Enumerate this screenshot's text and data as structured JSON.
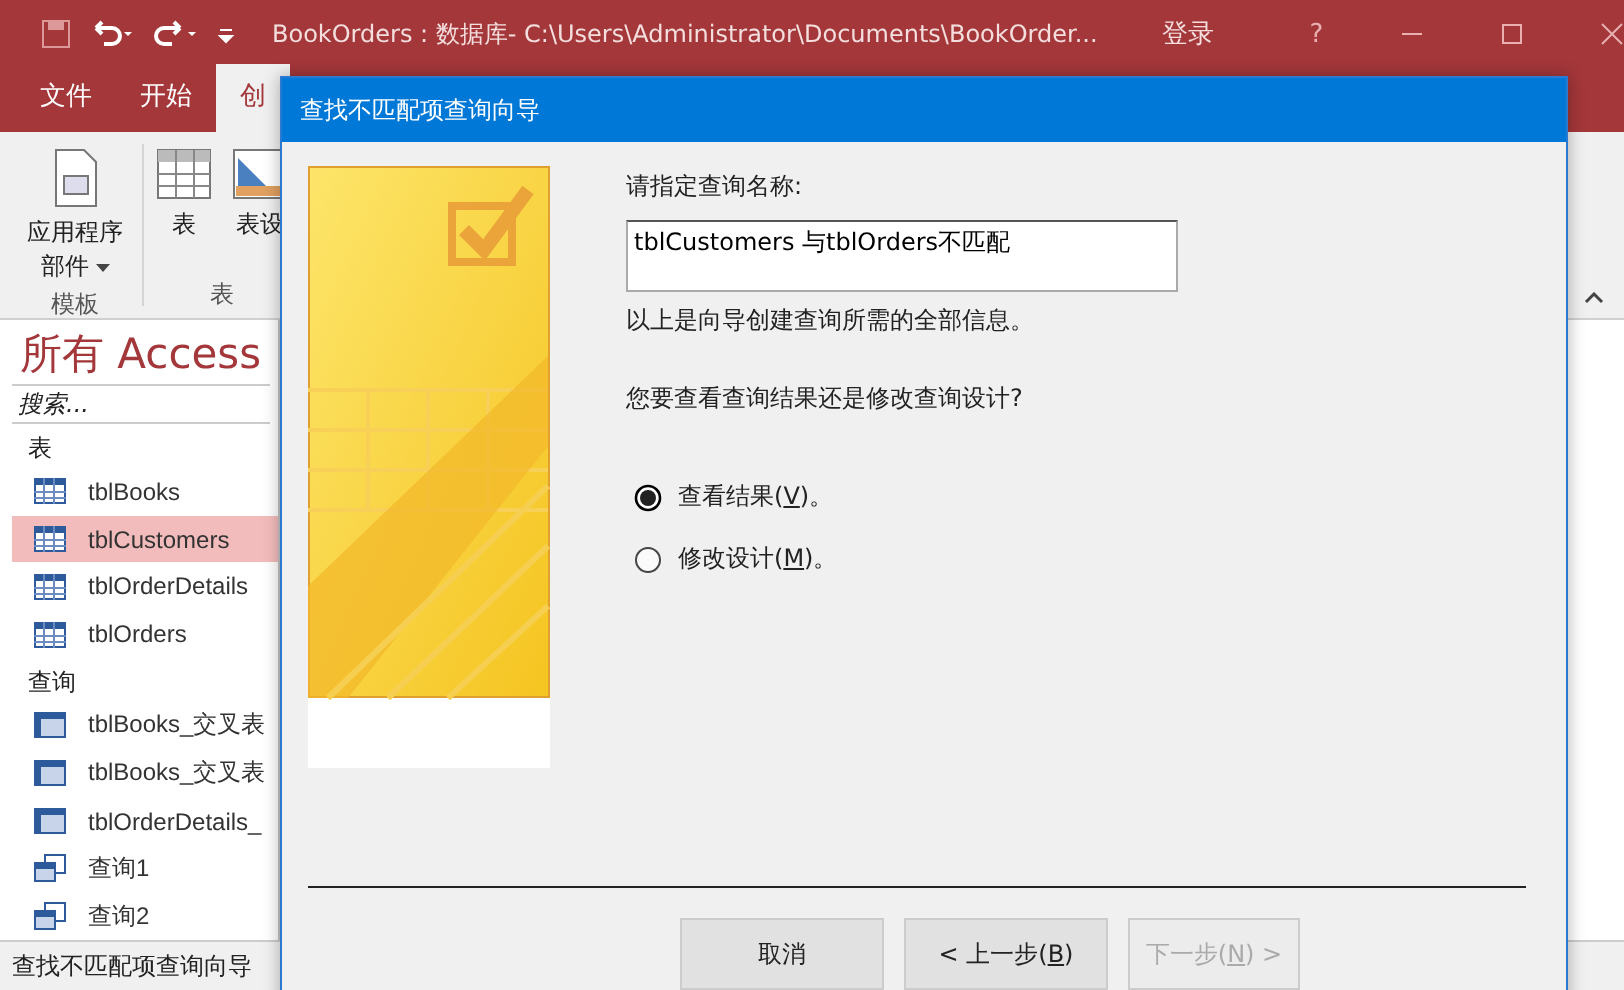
{
  "title_bar": {
    "title": "BookOrders : 数据库- C:\\Users\\Administrator\\Documents\\BookOrder...",
    "sign_in": "登录",
    "help": "?"
  },
  "ribbon_tabs": [
    {
      "label": "文件",
      "selected": false
    },
    {
      "label": "开始",
      "selected": false
    },
    {
      "label": "创",
      "selected": true
    }
  ],
  "ribbon": {
    "buttons": [
      {
        "label": "应用程序部件",
        "kind": "app-parts"
      },
      {
        "label": "表",
        "kind": "table"
      },
      {
        "label": "表设",
        "kind": "table-design"
      }
    ],
    "groups": [
      "模板",
      "表"
    ]
  },
  "nav_pane": {
    "title": "所有 Access",
    "search_placeholder": "搜索...",
    "groups": [
      {
        "label": "表",
        "items": [
          {
            "name": "tblBooks",
            "kind": "table",
            "selected": false
          },
          {
            "name": "tblCustomers",
            "kind": "table",
            "selected": true
          },
          {
            "name": "tblOrderDetails",
            "kind": "table",
            "selected": false
          },
          {
            "name": "tblOrders",
            "kind": "table",
            "selected": false
          }
        ]
      },
      {
        "label": "查询",
        "items": [
          {
            "name": "tblBooks_交叉表",
            "kind": "crosstab",
            "selected": false
          },
          {
            "name": "tblBooks_交叉表",
            "kind": "crosstab",
            "selected": false
          },
          {
            "name": "tblOrderDetails_",
            "kind": "crosstab",
            "selected": false
          },
          {
            "name": "查询1",
            "kind": "query",
            "selected": false
          },
          {
            "name": "查询2",
            "kind": "query",
            "selected": false
          }
        ]
      }
    ]
  },
  "status_bar": "查找不匹配项查询向导",
  "dialog": {
    "title": "查找不匹配项查询向导",
    "name_label": "请指定查询名称:",
    "name_value": "tblCustomers 与tblOrders不匹配",
    "info": "以上是向导创建查询所需的全部信息。",
    "question": "您要查看查询结果还是修改查询设计?",
    "options": [
      {
        "prefix": "查看结果(",
        "key": "V",
        "suffix": ")。",
        "selected": true
      },
      {
        "prefix": "修改设计(",
        "key": "M",
        "suffix": ")。",
        "selected": false
      }
    ],
    "buttons": [
      {
        "prefix": "取消",
        "disabled": false
      },
      {
        "prefix": "< 上一步(",
        "key": "B",
        "suffix": ")",
        "disabled": false
      },
      {
        "prefix": "下一步(",
        "key": "N",
        "suffix": ") >",
        "disabled": true
      }
    ]
  }
}
